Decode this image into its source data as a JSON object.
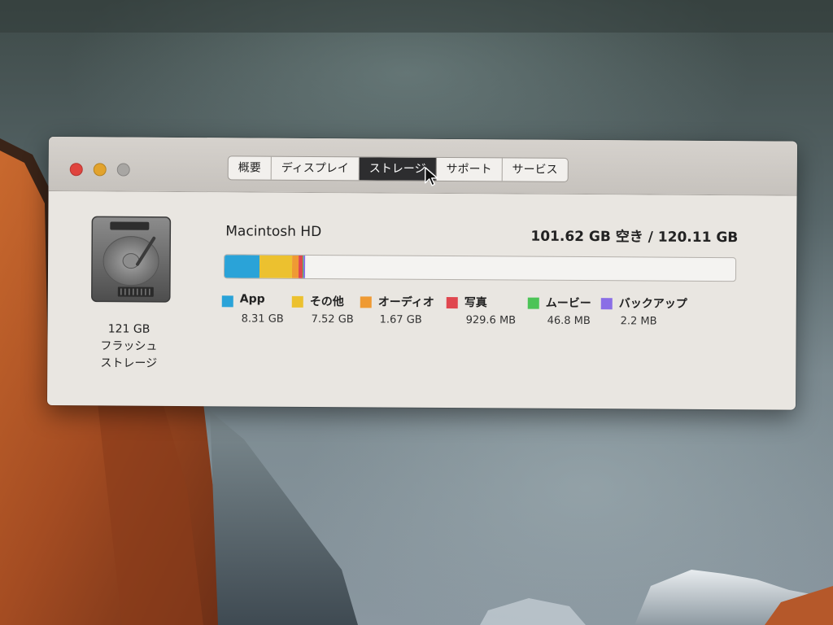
{
  "window": {
    "traffic_lights": {
      "close_color": "#e0443e",
      "minimize_color": "#e2a32d",
      "zoom_color": "#a8a6a3"
    },
    "tabs": [
      {
        "label": "概要",
        "active": false
      },
      {
        "label": "ディスプレイ",
        "active": false
      },
      {
        "label": "ストレージ",
        "active": true
      },
      {
        "label": "サポート",
        "active": false
      },
      {
        "label": "サービス",
        "active": false
      }
    ]
  },
  "drive": {
    "icon": "hard-drive-icon",
    "capacity": "121 GB",
    "type_line1": "フラッシュ",
    "type_line2": "ストレージ"
  },
  "volume": {
    "name": "Macintosh HD",
    "capacity_text": "101.62 GB 空き / 120.11 GB",
    "free_gb": 101.62,
    "total_gb": 120.11
  },
  "usage": [
    {
      "label": "App",
      "size": "8.31 GB",
      "gb": 8.31,
      "color": "#2aa3d8"
    },
    {
      "label": "その他",
      "size": "7.52 GB",
      "gb": 7.52,
      "color": "#ecc12f"
    },
    {
      "label": "オーディオ",
      "size": "1.67 GB",
      "gb": 1.67,
      "color": "#ef9a33"
    },
    {
      "label": "写真",
      "size": "929.6 MB",
      "gb": 0.9296,
      "color": "#e0474f"
    },
    {
      "label": "ムービー",
      "size": "46.8 MB",
      "gb": 0.0468,
      "color": "#4cc457"
    },
    {
      "label": "バックアップ",
      "size": "2.2 MB",
      "gb": 0.0022,
      "color": "#8a6ee6"
    }
  ]
}
